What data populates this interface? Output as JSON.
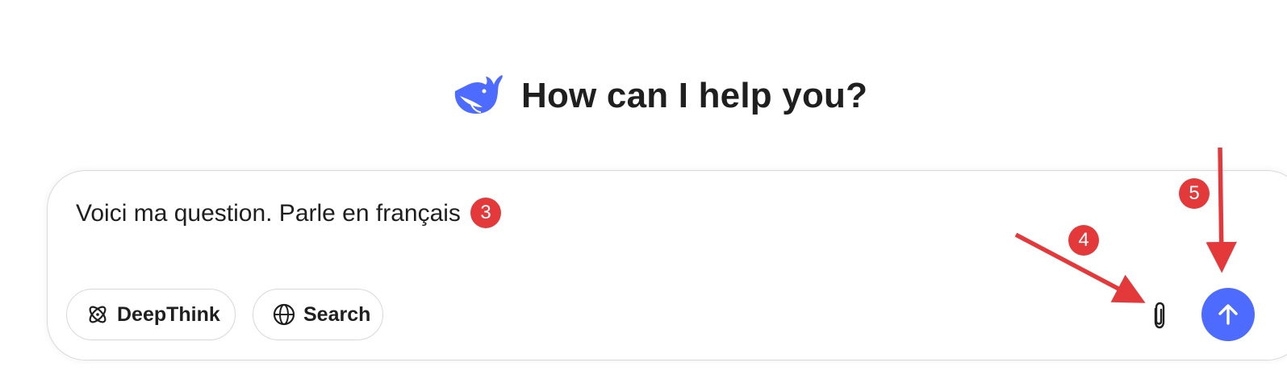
{
  "header": {
    "logo_icon": "deepseek-whale-logo",
    "title": "How can I help you?"
  },
  "composer": {
    "input_value": "Voici ma question. Parle en français",
    "buttons": {
      "deepthink_label": "DeepThink",
      "deepthink_icon": "atom-icon",
      "search_label": "Search",
      "search_icon": "globe-icon",
      "attach_icon": "paperclip-icon",
      "send_icon": "arrow-up-icon"
    }
  },
  "annotations": [
    {
      "number": "3",
      "target": "input"
    },
    {
      "number": "4",
      "target": "attach"
    },
    {
      "number": "5",
      "target": "send"
    }
  ],
  "colors": {
    "accent": "#4d6bfe",
    "annotation": "#e4393a",
    "text": "#1f1f1f",
    "border": "#d9d9d9"
  }
}
